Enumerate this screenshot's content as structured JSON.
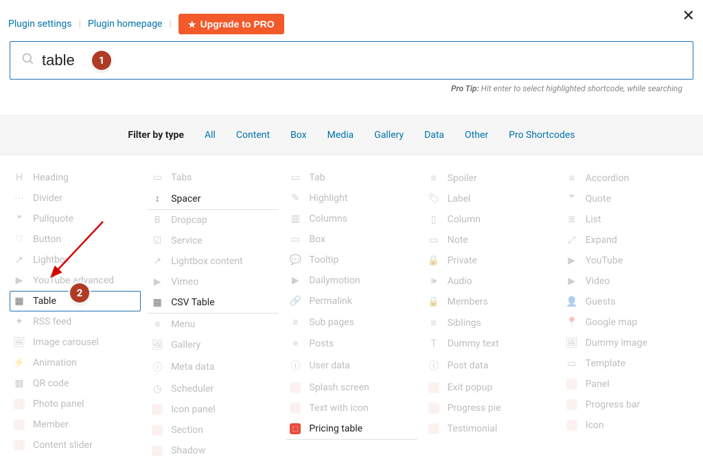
{
  "header": {
    "plugin_settings": "Plugin settings",
    "plugin_homepage": "Plugin homepage",
    "upgrade_label": "Upgrade to PRO"
  },
  "search": {
    "value": "table"
  },
  "protip": {
    "label": "Pro Tip:",
    "text": " Hit enter to select highlighted shortcode, while searching"
  },
  "filters": {
    "label": "Filter by type",
    "items": [
      "All",
      "Content",
      "Box",
      "Media",
      "Gallery",
      "Data",
      "Other",
      "Pro Shortcodes"
    ]
  },
  "callouts": {
    "one": "1",
    "two": "2"
  },
  "columns": [
    [
      {
        "label": "Heading",
        "icon": "H",
        "match": false
      },
      {
        "label": "Divider",
        "icon": "⋯",
        "match": false
      },
      {
        "label": "Pullquote",
        "icon": "❝",
        "match": false
      },
      {
        "label": "Button",
        "icon": "♡",
        "match": false
      },
      {
        "label": "Lightbox",
        "icon": "↗",
        "match": false
      },
      {
        "label": "YouTube advanced",
        "icon": "▶",
        "match": false
      },
      {
        "label": "Table",
        "icon": "▦",
        "match": true,
        "selected": true
      },
      {
        "label": "RSS feed",
        "icon": "✦",
        "match": false
      },
      {
        "label": "Image carousel",
        "icon": "🖼",
        "match": false
      },
      {
        "label": "Animation",
        "icon": "⚡",
        "match": false
      },
      {
        "label": "QR code",
        "icon": "▩",
        "match": false
      },
      {
        "label": "Photo panel",
        "icon": "pro",
        "match": false
      },
      {
        "label": "Member",
        "icon": "pro",
        "match": false
      },
      {
        "label": "Content slider",
        "icon": "pro",
        "match": false
      }
    ],
    [
      {
        "label": "Tabs",
        "icon": "▭",
        "match": false
      },
      {
        "label": "Spacer",
        "icon": "↕",
        "match": true
      },
      {
        "label": "Dropcap",
        "icon": "B",
        "match": false
      },
      {
        "label": "Service",
        "icon": "☑",
        "match": false
      },
      {
        "label": "Lightbox content",
        "icon": "↗",
        "match": false
      },
      {
        "label": "Vimeo",
        "icon": "▶",
        "match": false
      },
      {
        "label": "CSV Table",
        "icon": "▦",
        "match": true
      },
      {
        "label": "Menu",
        "icon": "≡",
        "match": false
      },
      {
        "label": "Gallery",
        "icon": "🖼",
        "match": false
      },
      {
        "label": "Meta data",
        "icon": "ⓘ",
        "match": false
      },
      {
        "label": "Scheduler",
        "icon": "◷",
        "match": false
      },
      {
        "label": "Icon panel",
        "icon": "pro",
        "match": false
      },
      {
        "label": "Section",
        "icon": "pro",
        "match": false
      },
      {
        "label": "Shadow",
        "icon": "pro",
        "match": false
      }
    ],
    [
      {
        "label": "Tab",
        "icon": "▭",
        "match": false
      },
      {
        "label": "Highlight",
        "icon": "✎",
        "match": false
      },
      {
        "label": "Columns",
        "icon": "▥",
        "match": false
      },
      {
        "label": "Box",
        "icon": "▭",
        "match": false
      },
      {
        "label": "Tooltip",
        "icon": "💬",
        "match": false
      },
      {
        "label": "Dailymotion",
        "icon": "▶",
        "match": false
      },
      {
        "label": "Permalink",
        "icon": "🔗",
        "match": false
      },
      {
        "label": "Sub pages",
        "icon": "≡",
        "match": false
      },
      {
        "label": "Posts",
        "icon": "≡",
        "match": false
      },
      {
        "label": "User data",
        "icon": "ⓘ",
        "match": false
      },
      {
        "label": "Splash screen",
        "icon": "pro",
        "match": false
      },
      {
        "label": "Text with icon",
        "icon": "pro",
        "match": false
      },
      {
        "label": "Pricing table",
        "icon": "pro-active",
        "match": true
      }
    ],
    [
      {
        "label": "Spoiler",
        "icon": "≡",
        "match": false
      },
      {
        "label": "Label",
        "icon": "🏷",
        "match": false
      },
      {
        "label": "Column",
        "icon": "▯",
        "match": false
      },
      {
        "label": "Note",
        "icon": "▭",
        "match": false
      },
      {
        "label": "Private",
        "icon": "🔒",
        "match": false
      },
      {
        "label": "Audio",
        "icon": "🕪",
        "match": false
      },
      {
        "label": "Members",
        "icon": "🔒",
        "match": false
      },
      {
        "label": "Siblings",
        "icon": "≡",
        "match": false
      },
      {
        "label": "Dummy text",
        "icon": "T",
        "match": false
      },
      {
        "label": "Post data",
        "icon": "ⓘ",
        "match": false
      },
      {
        "label": "Exit popup",
        "icon": "pro",
        "match": false
      },
      {
        "label": "Progress pie",
        "icon": "pro",
        "match": false
      },
      {
        "label": "Testimonial",
        "icon": "pro",
        "match": false
      }
    ],
    [
      {
        "label": "Accordion",
        "icon": "≡",
        "match": false
      },
      {
        "label": "Quote",
        "icon": "❞",
        "match": false
      },
      {
        "label": "List",
        "icon": "≣",
        "match": false
      },
      {
        "label": "Expand",
        "icon": "⤢",
        "match": false
      },
      {
        "label": "YouTube",
        "icon": "▶",
        "match": false
      },
      {
        "label": "Video",
        "icon": "▶",
        "match": false
      },
      {
        "label": "Guests",
        "icon": "👤",
        "match": false
      },
      {
        "label": "Google map",
        "icon": "📍",
        "match": false
      },
      {
        "label": "Dummy image",
        "icon": "🖼",
        "match": false
      },
      {
        "label": "Template",
        "icon": "▭",
        "match": false
      },
      {
        "label": "Panel",
        "icon": "pro",
        "match": false
      },
      {
        "label": "Progress bar",
        "icon": "pro",
        "match": false
      },
      {
        "label": "Icon",
        "icon": "pro",
        "match": false
      }
    ]
  ]
}
